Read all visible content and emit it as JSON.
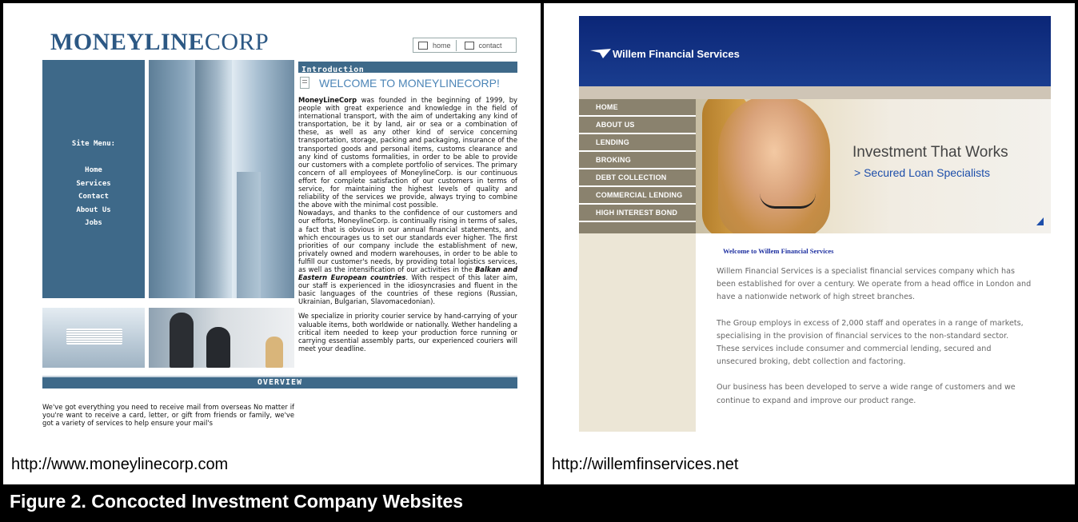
{
  "figure": {
    "caption": "Figure 2.  Concocted Investment Company Websites"
  },
  "left": {
    "url": "http://www.moneylinecorp.com",
    "logo_bold": "MONEYLINE",
    "logo_rest": "CORP",
    "topnav": {
      "home": "home",
      "contact": "contact"
    },
    "site_menu_heading": "Site Menu:",
    "menu": [
      "Home",
      "Services",
      "Contact",
      "About Us",
      "Jobs"
    ],
    "intro_heading": "Introduction",
    "welcome_heading": "WELCOME TO MONEYLINECORP!",
    "intro_lead": "MoneyLineCorp",
    "intro_p1": " was founded in the beginning of 1999, by people with great experience and knowledge in the field of international transport, with the aim of undertaking any kind of transportation, be it by land, air or sea or a combination of these, as well as any other kind of service concerning transportation, storage, packing and packaging, insurance of the transported goods and personal items, customs clearance and any kind of customs formalities, in order to be able to provide our customers with a complete portfolio of services. The primary concern of all employees of MoneylineCorp. is our continuous effort for complete satisfaction of our customers in terms of service, for maintaining the highest levels of quality and reliability of the services we provide, always trying to combine the above with the minimal cost possible.",
    "intro_p2_start": "Nowadays, and thanks to the confidence of our customers and our efforts, MoneylineCorp. is continually rising in terms of sales, a fact that is obvious in our annual financial statements, and which encourages us to set our standards ever higher. The first priorities of our company include the establishment of new, privately owned and modern warehouses, in order to be able to fulfill our customer's needs, by providing total logistics services, as well as the intensification of our activities in the ",
    "intro_p2_em": "Balkan and Eastern European countries",
    "intro_p2_end": ". With respect of this later aim, our staff is experienced in the idiosyncrasies and fluent in the basic languages of the countries of these regions (Russian, Ukrainian, Bulgarian, Slavomacedonian).",
    "intro_p3": "We specialize in priority courier service by hand-carrying of your valuable items, both worldwide or nationally. Wether handeling a critical item needed to keep your production force running or carrying essential assembly parts, our experienced couriers will meet your deadline.",
    "overview_heading": "OVERVIEW",
    "overview_text": "We've got everything you need to receive mail from overseas No matter if you're want to receive a card, letter, or gift from friends or family, we've got a variety of services to help ensure your mail's"
  },
  "right": {
    "url": "http://willemfinservices.net",
    "brand": "Willem Financial Services",
    "nav": [
      "HOME",
      "ABOUT US",
      "LENDING",
      "BROKING",
      "DEBT COLLECTION",
      "COMMERCIAL LENDING",
      "HIGH INTEREST BOND"
    ],
    "hero_title": "Investment That Works",
    "hero_subtitle": "> Secured Loan Specialists",
    "welcome": "Welcome to Willem Financial Services",
    "paragraphs": [
      "Willem Financial Services is a specialist financial services company which has been established for over a century. We operate from a head office in London and have a nationwide network of high street branches.",
      "The Group employs in excess of 2,000 staff and operates in a range of markets, specialising in the provision of financial services to the non-standard sector. These services include consumer and commercial lending, secured and unsecured broking, debt collection and factoring.",
      "Our business has been developed to serve a wide range of customers and we continue to expand and improve our product range."
    ]
  }
}
